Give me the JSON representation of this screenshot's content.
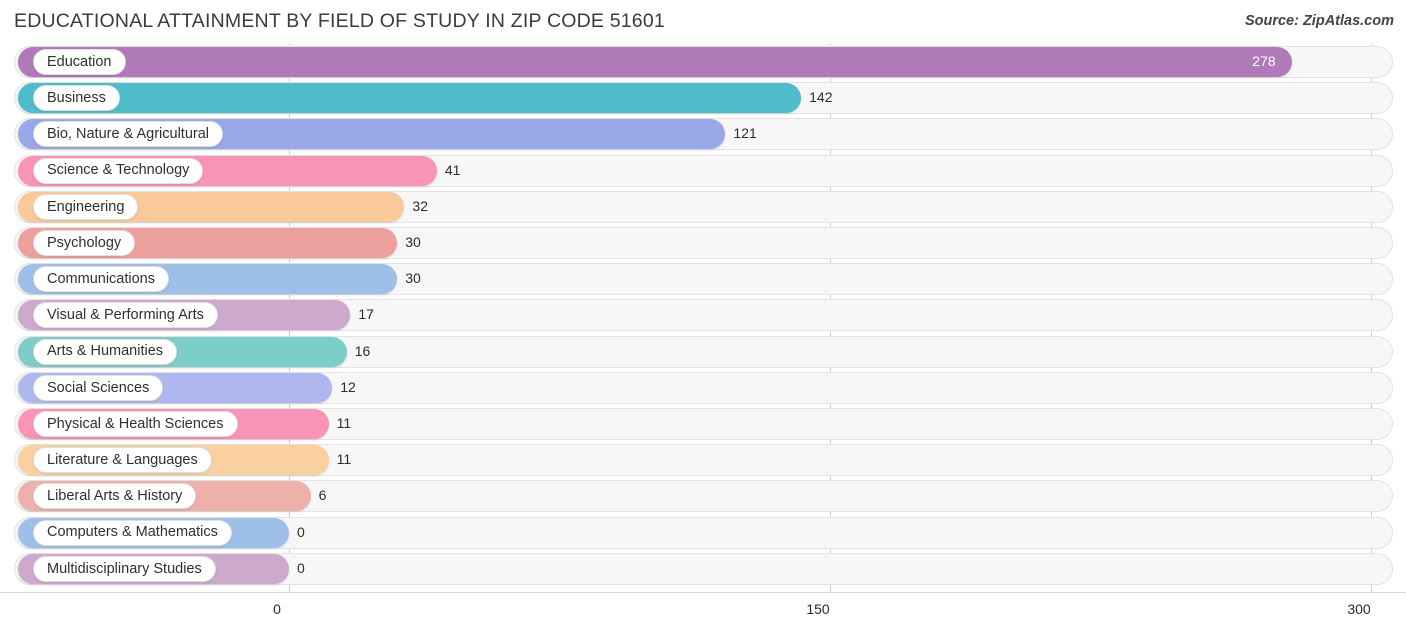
{
  "header": {
    "title": "EDUCATIONAL ATTAINMENT BY FIELD OF STUDY IN ZIP CODE 51601",
    "source": "Source: ZipAtlas.com"
  },
  "chart_data": {
    "type": "bar",
    "orientation": "horizontal",
    "title": "EDUCATIONAL ATTAINMENT BY FIELD OF STUDY IN ZIP CODE 51601",
    "xlabel": "",
    "ylabel": "",
    "xlim": [
      0,
      300
    ],
    "xticks": [
      "0",
      "150",
      "300"
    ],
    "xtick_values": [
      0,
      150,
      300
    ],
    "grid": true,
    "legend": false,
    "categories": [
      "Education",
      "Business",
      "Bio, Nature & Agricultural",
      "Science & Technology",
      "Engineering",
      "Psychology",
      "Communications",
      "Visual & Performing Arts",
      "Arts & Humanities",
      "Social Sciences",
      "Physical & Health Sciences",
      "Literature & Languages",
      "Liberal Arts & History",
      "Computers & Mathematics",
      "Multidisciplinary Studies"
    ],
    "values": [
      278,
      142,
      121,
      41,
      32,
      30,
      30,
      17,
      16,
      12,
      11,
      11,
      6,
      0,
      0
    ],
    "value_labels": [
      "278",
      "142",
      "121",
      "41",
      "32",
      "30",
      "30",
      "17",
      "16",
      "12",
      "11",
      "11",
      "6",
      "0",
      "0"
    ],
    "colors": [
      "#b07ab8",
      "#4fbdc9",
      "#9aa7e8",
      "#f993b8",
      "#fac99a",
      "#eda19f",
      "#9ec0e8",
      "#cda9cc",
      "#7ccfc9",
      "#aeb8ee",
      "#f993b8",
      "#fad0a0",
      "#eeb0ab",
      "#9ec0e8",
      "#cda9cc"
    ]
  }
}
